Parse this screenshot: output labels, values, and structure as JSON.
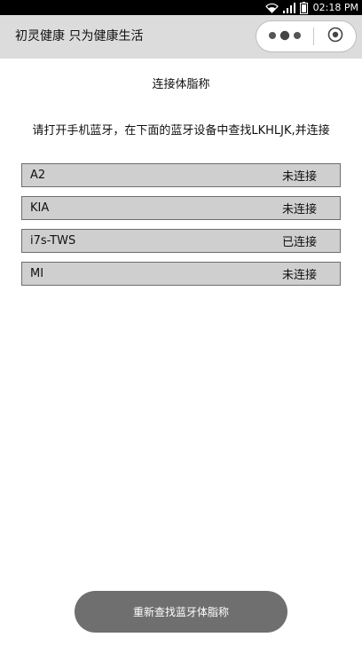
{
  "status_bar": {
    "time": "02:18 PM",
    "icons": [
      "wifi-icon",
      "signal-icon",
      "battery-icon"
    ]
  },
  "title_bar": {
    "app_title": "初灵健康 只为健康生活",
    "capsule": {
      "more_icon": "three-dots-icon",
      "close_icon": "target-circle-icon"
    }
  },
  "main": {
    "page_title": "连接体脂称",
    "instruction": "请打开手机蓝牙，在下面的蓝牙设备中查找LKHLJK,并连接",
    "devices": [
      {
        "name": "A2",
        "status": "未连接"
      },
      {
        "name": "KIA",
        "status": "未连接"
      },
      {
        "name": "i7s-TWS",
        "status": "已连接"
      },
      {
        "name": "MI",
        "status": "未连接"
      }
    ],
    "rescan_label": "重新查找蓝牙体脂称"
  },
  "colors": {
    "status_bar_bg": "#000000",
    "title_bar_bg": "#dcdcdc",
    "device_item_bg": "#cfcfcf",
    "button_bg": "#6f6f6f"
  }
}
